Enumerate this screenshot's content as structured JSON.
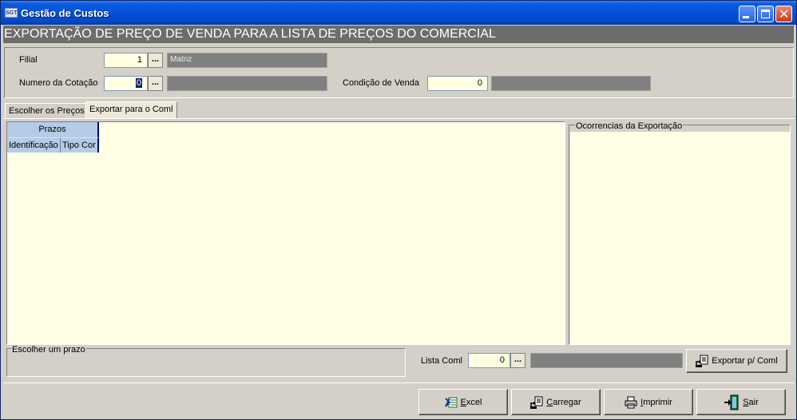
{
  "window": {
    "title": "Gestão de Custos",
    "app_icon_text": "SGT"
  },
  "banner": {
    "text": "EXPORTAÇÃO DE PREÇO DE VENDA PARA A LISTA DE PREÇOS DO COMERCIAL"
  },
  "filters": {
    "filial_label": "Filial",
    "filial_value": "1",
    "filial_desc": "Matriz",
    "cotacao_label": "Numero da Cotação",
    "cotacao_value": "0",
    "cotacao_desc": "",
    "condicao_label": "Condição de Venda",
    "condicao_value": "0",
    "condicao_desc": "",
    "ellipsis": "..."
  },
  "tabs": [
    {
      "label": "Escolher os Preços",
      "active": false
    },
    {
      "label": "Exportar para o Coml",
      "active": true
    }
  ],
  "grid": {
    "group_header": "Prazos",
    "columns": [
      "Identificação",
      "Tipo Cor"
    ]
  },
  "occurrences": {
    "legend": "Ocorrencias da Exportação"
  },
  "term_group": {
    "legend": "Escolher um prazo"
  },
  "export_row": {
    "lista_label": "Lista Coml",
    "lista_value": "0",
    "lista_desc": "",
    "export_button": "Exportar p/ Coml"
  },
  "bottom_buttons": {
    "excel": {
      "mnemonic": "E",
      "rest": "xcel"
    },
    "carregar": {
      "mnemonic": "C",
      "rest": "arregar"
    },
    "imprimir": {
      "mnemonic": "I",
      "rest": "mprimir"
    },
    "sair": {
      "mnemonic": "S",
      "rest": "air"
    }
  },
  "colors": {
    "titlebar": "#0052d9",
    "banner": "#6d6d6d",
    "field_bg": "#ffffe1",
    "grid_header": "#b5cbe6",
    "desc_bg": "#808080"
  }
}
